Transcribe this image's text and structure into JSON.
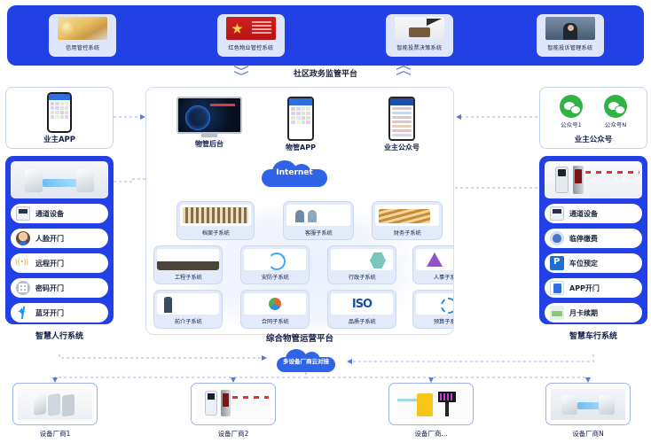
{
  "gov": {
    "label": "社区政务监管平台",
    "cards": [
      {
        "title": "信用管控系统",
        "art": "art-money",
        "icon_name": "credit-thumb"
      },
      {
        "title": "红色物业管控系统",
        "art": "art-flag",
        "icon_name": "party-flag-thumb"
      },
      {
        "title": "智能投票决策系统",
        "art": "art-meet",
        "icon_name": "meeting-thumb"
      },
      {
        "title": "智能投诉管理系统",
        "art": "art-office",
        "icon_name": "office-thumb"
      }
    ],
    "chevron_down": "chevron-double-down-icon",
    "chevron_up": "chevron-double-up-icon"
  },
  "left": {
    "owner_app": {
      "caption": "业主APP"
    },
    "panel_caption": "智慧人行系统",
    "features": [
      {
        "label": "通道设备",
        "icon": "ic-device",
        "icon_name": "channel-device-icon"
      },
      {
        "label": "人脸开门",
        "icon": "ic-face",
        "icon_name": "face-recognition-icon"
      },
      {
        "label": "远程开门",
        "icon": "ic-signal",
        "icon_name": "remote-signal-icon"
      },
      {
        "label": "密码开门",
        "icon": "ic-keypad",
        "icon_name": "keypad-icon"
      },
      {
        "label": "蓝牙开门",
        "icon": "ic-bt",
        "icon_name": "bluetooth-icon"
      }
    ]
  },
  "right": {
    "owner_wx": {
      "caption": "业主公众号",
      "accounts": [
        {
          "label": "公众号1"
        },
        {
          "label": "公众号N"
        }
      ]
    },
    "panel_caption": "智慧车行系统",
    "features": [
      {
        "label": "通道设备",
        "icon": "ic-device",
        "icon_name": "channel-device-icon"
      },
      {
        "label": "临停缴费",
        "icon": "ic-money",
        "icon_name": "temp-parking-fee-icon"
      },
      {
        "label": "车位预定",
        "icon": "ic-park",
        "icon_name": "parking-reserve-icon"
      },
      {
        "label": "APP开门",
        "icon": "ic-appdoor",
        "icon_name": "app-open-door-icon"
      },
      {
        "label": "月卡续期",
        "icon": "ic-card",
        "icon_name": "monthly-card-renew-icon"
      }
    ]
  },
  "center": {
    "caption": "综合物管运营平台",
    "cloud": {
      "label": "Internet",
      "icon_name": "internet-cloud-icon"
    },
    "cloud2": {
      "label": "多设备厂商云对接",
      "icon_name": "vendor-cloud-icon"
    },
    "nodes": [
      {
        "caption": "物管后台",
        "type": "monitor",
        "icon_name": "console-monitor"
      },
      {
        "caption": "物管APP",
        "type": "phone",
        "icon_name": "management-phone"
      },
      {
        "caption": "业主公众号",
        "type": "phone-wx",
        "icon_name": "owner-wechat-phone"
      }
    ],
    "subsystems_row1": [
      {
        "label": "档案子系统",
        "art": "t-archive"
      },
      {
        "label": "客服子系统",
        "art": "t-service"
      },
      {
        "label": "财务子系统",
        "art": "t-finance"
      }
    ],
    "subsystems_row2": [
      {
        "label": "工程子系统",
        "art": "t-eng"
      },
      {
        "label": "安防子系统",
        "art": "t-sec"
      },
      {
        "label": "行政子系统",
        "art": "t-admin"
      },
      {
        "label": "人事子系统",
        "art": "t-hr"
      }
    ],
    "subsystems_row3": [
      {
        "label": "前介子系统",
        "art": "t-pre"
      },
      {
        "label": "合同子系统",
        "art": "t-contract"
      },
      {
        "label": "品质子系统",
        "art": "t-iso"
      },
      {
        "label": "预算子系统",
        "art": "t-budget"
      }
    ]
  },
  "vendors": [
    {
      "label": "设备厂商1",
      "art": "va-turnstile"
    },
    {
      "label": "设备厂商2",
      "art": "va-kiosk"
    },
    {
      "label": "设备厂商...",
      "art": "va-barrier"
    },
    {
      "label": "设备厂商N",
      "art": "va-gate"
    }
  ],
  "colors": {
    "brand_blue": "#2140e6",
    "cloud_blue": "#2f63e8",
    "card_blue": "#dfe6fb",
    "sub_card": "#e3eaf9",
    "wire": "#8aa0d8",
    "wechat_green": "#2fb344"
  }
}
